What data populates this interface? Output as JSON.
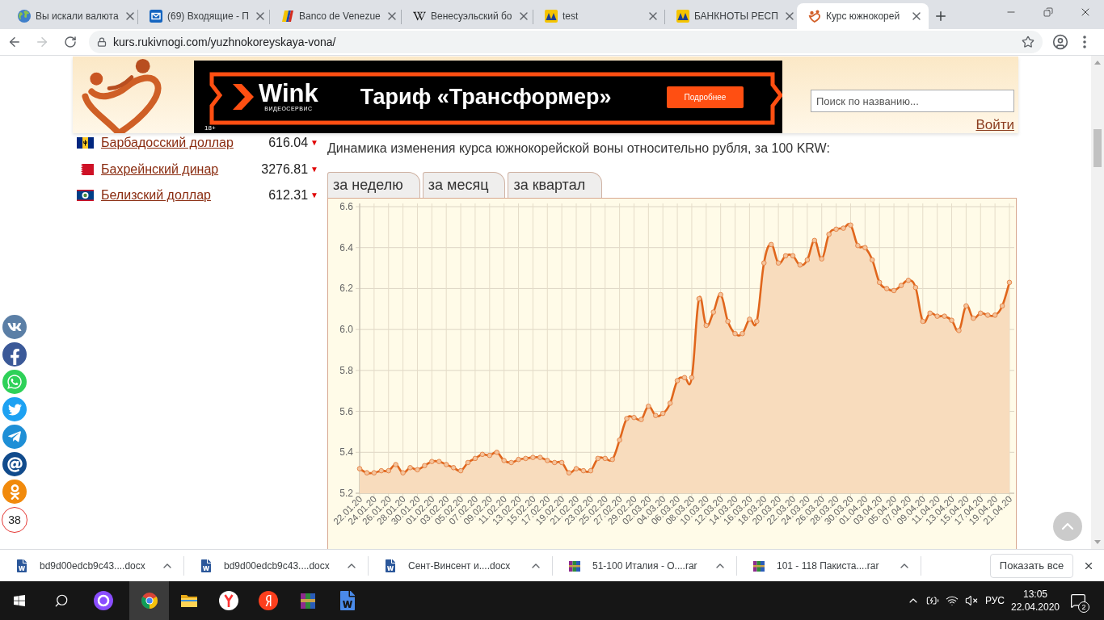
{
  "browser": {
    "tabs": [
      {
        "kind": "globe",
        "title": "Вы искали валюта",
        "selected": false
      },
      {
        "kind": "mail",
        "title": "(69) Входящие - П",
        "selected": false
      },
      {
        "kind": "shield",
        "title": "Banco de Venezue",
        "selected": false
      },
      {
        "kind": "wiki",
        "title": "Венесуэльский бо",
        "selected": false
      },
      {
        "kind": "mm",
        "title": "test",
        "selected": false
      },
      {
        "kind": "mm",
        "title": "БАНКНОТЫ РЕСП",
        "selected": false
      },
      {
        "kind": "heart",
        "title": "Курс южнокорей",
        "selected": true
      }
    ],
    "url": "kurs.rukivnogi.com/yuzhnokoreyskaya-vona/"
  },
  "header": {
    "ad": {
      "brand": "Wink",
      "brand_tagline": "ВИДЕОСЕРВИС",
      "headline": "Тариф «Трансформер»",
      "button": "Подробнее",
      "age_rating": "18+"
    },
    "search": {
      "placeholder": "Поиск по названию..."
    },
    "login": "Войти"
  },
  "currencies": [
    {
      "kind": "barbados",
      "name": "Барбадосский доллар",
      "rate": "616.04",
      "change": "▼"
    },
    {
      "kind": "bahrain",
      "name": "Бахрейнский динар",
      "rate": "3276.81",
      "change": "▼"
    },
    {
      "kind": "belize",
      "name": "Белизский доллар",
      "rate": "612.31",
      "change": "▼"
    }
  ],
  "rate_chart": {
    "caption": "Динамика изменения курса южнокорейской воны относительно рубля, за 100 KRW:",
    "periods": [
      {
        "label": "за неделю"
      },
      {
        "label": "за месяц"
      },
      {
        "label": "за квартал"
      }
    ],
    "chart_data": {
      "type": "area",
      "grid": true,
      "categories": [
        "22.01.20",
        null,
        "24.01.20",
        null,
        "26.01.20",
        null,
        "28.01.20",
        null,
        "30.01.20",
        null,
        "01.02.20",
        null,
        "03.02.20",
        null,
        "05.02.20",
        null,
        "07.02.20",
        null,
        "09.02.20",
        null,
        "11.02.20",
        null,
        "13.02.20",
        null,
        "15.02.20",
        null,
        "17.02.20",
        null,
        "19.02.20",
        null,
        "21.02.20",
        null,
        "23.02.20",
        null,
        "25.02.20",
        null,
        "27.02.20",
        null,
        "29.02.20",
        null,
        "02.03.20",
        null,
        "04.03.20",
        null,
        "06.03.20",
        null,
        "08.03.20",
        null,
        "10.03.20",
        null,
        "12.03.20",
        null,
        "14.03.20",
        null,
        "16.03.20",
        null,
        "18.03.20",
        null,
        "20.03.20",
        null,
        "22.03.20",
        null,
        "24.03.20",
        null,
        "26.03.20",
        null,
        "28.03.20",
        null,
        "30.03.20",
        null,
        "01.04.20",
        null,
        "03.04.20",
        null,
        "05.04.20",
        null,
        "07.04.20",
        null,
        "09.04.20",
        null,
        "11.04.20",
        null,
        "13.04.20",
        null,
        "15.04.20",
        null,
        "17.04.20",
        null,
        "19.04.20",
        null,
        "21.04.20"
      ],
      "values": [
        5.32,
        5.3,
        5.3,
        5.31,
        5.31,
        5.34,
        5.3,
        5.325,
        5.315,
        5.335,
        5.355,
        5.355,
        5.34,
        5.325,
        5.31,
        5.35,
        5.37,
        5.39,
        5.385,
        5.4,
        5.36,
        5.35,
        5.365,
        5.37,
        5.375,
        5.375,
        5.36,
        5.35,
        5.35,
        5.3,
        5.32,
        5.31,
        5.31,
        5.37,
        5.37,
        5.365,
        5.46,
        5.565,
        5.57,
        5.56,
        5.625,
        5.58,
        5.59,
        5.64,
        5.75,
        5.765,
        5.765,
        6.15,
        6.02,
        6.085,
        6.17,
        6.04,
        5.98,
        5.98,
        6.05,
        6.04,
        6.325,
        6.415,
        6.325,
        6.36,
        6.36,
        6.315,
        6.34,
        6.435,
        6.345,
        6.465,
        6.49,
        6.495,
        6.51,
        6.41,
        6.4,
        6.34,
        6.23,
        6.2,
        6.19,
        6.215,
        6.24,
        6.205,
        6.04,
        6.08,
        6.065,
        6.065,
        6.045,
        5.995,
        6.115,
        6.055,
        6.08,
        6.07,
        6.07,
        6.115,
        6.23
      ],
      "ylim": [
        5.2,
        6.6
      ],
      "yticks": [
        {
          "value": 5.2,
          "label": "5.2"
        },
        {
          "value": 5.4,
          "label": "5.4"
        },
        {
          "value": 5.6,
          "label": "5.6"
        },
        {
          "value": 5.8,
          "label": "5.8"
        },
        {
          "value": 6.0,
          "label": "6.0"
        },
        {
          "value": 6.2,
          "label": "6.2"
        },
        {
          "value": 6.4,
          "label": "6.4"
        },
        {
          "value": 6.6,
          "label": "6.6"
        }
      ]
    }
  },
  "share": {
    "counter": "38"
  },
  "downloads": {
    "items": [
      {
        "kind": "word",
        "name": "bd9d00edcb9c43....docx"
      },
      {
        "kind": "word",
        "name": "bd9d00edcb9c43....docx"
      },
      {
        "kind": "word",
        "name": "Сент-Винсент и....docx"
      },
      {
        "kind": "archive",
        "name": "51-100 Италия - О....rar"
      },
      {
        "kind": "archive",
        "name": "101 - 118 Пакиста....rar"
      }
    ],
    "show_all": "Показать все"
  },
  "taskbar": {
    "apps": [
      {
        "kind": "chrome",
        "selected": true
      },
      {
        "kind": "folder",
        "selected": false
      },
      {
        "kind": "yandex-browser",
        "selected": false
      },
      {
        "kind": "yandex",
        "selected": false
      },
      {
        "kind": "archiver",
        "selected": false
      },
      {
        "kind": "word",
        "selected": false
      }
    ],
    "language": "РУС",
    "time": "13:05",
    "date": "22.04.2020",
    "notifications": "2"
  }
}
